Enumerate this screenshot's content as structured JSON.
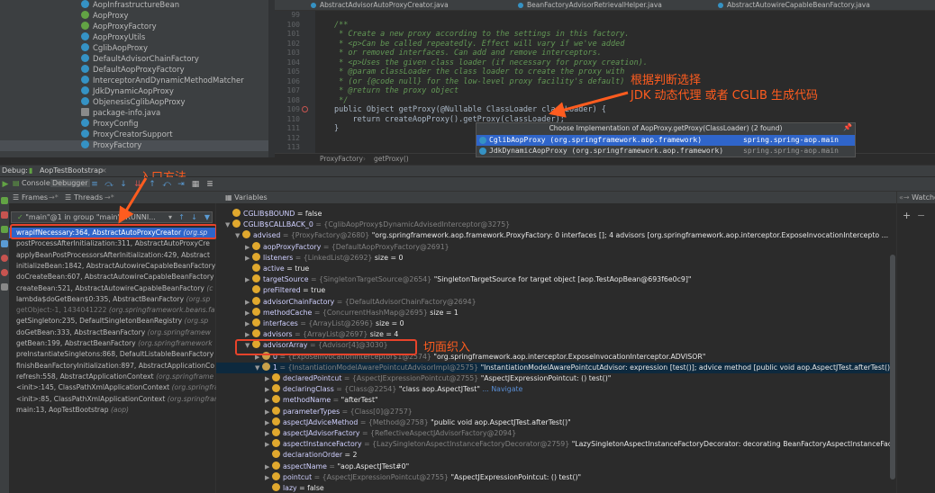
{
  "project_tree": {
    "items": [
      {
        "label": "AopInfrastructureBean",
        "icon": "class-icon"
      },
      {
        "label": "AopProxy",
        "icon": "interface-icon"
      },
      {
        "label": "AopProxyFactory",
        "icon": "interface-icon"
      },
      {
        "label": "AopProxyUtils",
        "icon": "class-icon"
      },
      {
        "label": "CglibAopProxy",
        "icon": "class-icon"
      },
      {
        "label": "DefaultAdvisorChainFactory",
        "icon": "class-icon"
      },
      {
        "label": "DefaultAopProxyFactory",
        "icon": "class-icon"
      },
      {
        "label": "InterceptorAndDynamicMethodMatcher",
        "icon": "class-icon"
      },
      {
        "label": "JdkDynamicAopProxy",
        "icon": "class-icon"
      },
      {
        "label": "ObjenesisCglibAopProxy",
        "icon": "class-icon"
      },
      {
        "label": "package-info.java",
        "icon": "file-icon"
      },
      {
        "label": "ProxyConfig",
        "icon": "class-icon"
      },
      {
        "label": "ProxyCreatorSupport",
        "icon": "class-icon"
      },
      {
        "label": "ProxyFactory",
        "icon": "class-icon"
      }
    ]
  },
  "editor_tabs": [
    {
      "label": "AbstractAdvisorAutoProxyCreator.java"
    },
    {
      "label": "BeanFactoryAdvisorRetrievalHelper.java"
    },
    {
      "label": "AbstractAutowireCapableBeanFactory.java"
    }
  ],
  "editor": {
    "line_numbers": [
      "99",
      "100",
      "101",
      "102",
      "103",
      "104",
      "105",
      "106",
      "107",
      "108",
      "109",
      "110",
      "111",
      "112",
      "113"
    ],
    "lines": [
      "",
      "/**",
      " * Create a new proxy according to the settings in this factory.",
      " * <p>Can be called repeatedly. Effect will vary if we've added",
      " * or removed interfaces. Can add and remove interceptors.",
      " * <p>Uses the given class loader (if necessary for proxy creation).",
      " * @param classLoader the class loader to create the proxy with",
      " * (or {@code null} for the low-level proxy facility's default)",
      " * @return the proxy object",
      " */",
      "public Object getProxy(@Nullable ClassLoader classLoader) {",
      "    return createAopProxy().getProxy(classLoader);",
      "}",
      "",
      ""
    ],
    "breadcrumb": [
      "ProxyFactory",
      "getProxy()"
    ]
  },
  "annotations": {
    "editor_note_line1": "根据判断选择",
    "editor_note_line2": "JDK 动态代理 或者 CGLIB 生成代码",
    "entry_note": "入口方法",
    "aop_note": "切面织入"
  },
  "implementations_popup": {
    "title": "Choose Implementation of AopProxy.getProxy(ClassLoader) (2 found)",
    "rows": [
      {
        "cls": "CglibAopProxy (org.springframework.aop.framework)",
        "module": "spring.spring-aop.main"
      },
      {
        "cls": "JdkDynamicAopProxy (org.springframework.aop.framework)",
        "module": "spring.spring-aop.main"
      }
    ]
  },
  "debug_bar": {
    "debug_label": "Debug:",
    "config_name": "AopTestBootstrap"
  },
  "toolbar": {
    "console_tab": "Console",
    "debugger_tab": "Debugger"
  },
  "frames_panel": {
    "frames_label": "Frames",
    "threads_label": "Threads",
    "thread_selector": "\"main\"@1 in group \"main\": RUNNI...",
    "frames": [
      {
        "m": "wrapIfNecessary:364, AbstractAutoProxyCreator",
        "p": "(org.sp"
      },
      {
        "m": "postProcessAfterInitialization:311, AbstractAutoProxyCre",
        "p": ""
      },
      {
        "m": "applyBeanPostProcessorsAfterInitialization:429, Abstract",
        "p": ""
      },
      {
        "m": "initializeBean:1842, AbstractAutowireCapableBeanFactory",
        "p": ""
      },
      {
        "m": "doCreateBean:607, AbstractAutowireCapableBeanFactory",
        "p": ""
      },
      {
        "m": "createBean:521, AbstractAutowireCapableBeanFactory",
        "p": "(c"
      },
      {
        "m": "lambda$doGetBean$0:335, AbstractBeanFactory",
        "p": "(org.sp"
      },
      {
        "m": "getObject:-1, 1434041222",
        "p": "(org.springframework.beans.fa"
      },
      {
        "m": "getSingleton:235, DefaultSingletonBeanRegistry",
        "p": "(org.sp"
      },
      {
        "m": "doGetBean:333, AbstractBeanFactory",
        "p": "(org.springframew"
      },
      {
        "m": "getBean:199, AbstractBeanFactory",
        "p": "(org.springframework"
      },
      {
        "m": "preInstantiateSingletons:868, DefaultListableBeanFactory",
        "p": ""
      },
      {
        "m": "finishBeanFactoryInitialization:897, AbstractApplicationCo",
        "p": ""
      },
      {
        "m": "refresh:558, AbstractApplicationContext",
        "p": "(org.springframe"
      },
      {
        "m": "<init>:145, ClassPathXmlApplicationContext",
        "p": "(org.springfra"
      },
      {
        "m": "<init>:85, ClassPathXmlApplicationContext",
        "p": "(org.springfram"
      },
      {
        "m": "main:13, AopTestBootstrap",
        "p": "(aop)"
      }
    ]
  },
  "variables_panel": {
    "title": "Variables",
    "rows": [
      {
        "indent": 0,
        "tri": "",
        "icon": "static",
        "name": "CGLIB$BOUND",
        "type": "",
        "value": "= false"
      },
      {
        "indent": 0,
        "tri": "▼",
        "icon": "static",
        "name": "CGLIB$CALLBACK_0",
        "type": "= {CglibAopProxy$DynamicAdvisedInterceptor@3275}",
        "value": ""
      },
      {
        "indent": 1,
        "tri": "▼",
        "icon": "field",
        "name": "advised",
        "type": "= {ProxyFactory@2680}",
        "value": "\"org.springframework.aop.framework.ProxyFactory: 0 interfaces []; 4 advisors [org.springframework.aop.interceptor.ExposeInvocationIntercepto ...",
        "link": "View"
      },
      {
        "indent": 2,
        "tri": "▶",
        "icon": "field",
        "name": "aopProxyFactory",
        "type": "= {DefaultAopProxyFactory@2691}",
        "value": ""
      },
      {
        "indent": 2,
        "tri": "▶",
        "icon": "field",
        "name": "listeners",
        "type": "= {LinkedList@2692}",
        "value": "size = 0"
      },
      {
        "indent": 2,
        "tri": "",
        "icon": "field",
        "name": "active",
        "type": "",
        "value": "= true"
      },
      {
        "indent": 2,
        "tri": "▶",
        "icon": "field",
        "name": "targetSource",
        "type": "= {SingletonTargetSource@2654}",
        "value": "\"SingletonTargetSource for target object [aop.TestAopBean@693f6e0c9]\""
      },
      {
        "indent": 2,
        "tri": "",
        "icon": "field",
        "name": "preFiltered",
        "type": "",
        "value": "= true"
      },
      {
        "indent": 2,
        "tri": "▶",
        "icon": "field",
        "name": "advisorChainFactory",
        "type": "= {DefaultAdvisorChainFactory@2694}",
        "value": ""
      },
      {
        "indent": 2,
        "tri": "▶",
        "icon": "field",
        "name": "methodCache",
        "type": "= {ConcurrentHashMap@2695}",
        "value": "size = 1"
      },
      {
        "indent": 2,
        "tri": "▶",
        "icon": "field",
        "name": "interfaces",
        "type": "= {ArrayList@2696}",
        "value": "size = 0"
      },
      {
        "indent": 2,
        "tri": "▶",
        "icon": "field",
        "name": "advisors",
        "type": "= {ArrayList@2697}",
        "value": "size = 4"
      },
      {
        "indent": 2,
        "tri": "▼",
        "icon": "field",
        "name": "advisorArray",
        "type": "= {Advisor[4]@3030}",
        "value": ""
      },
      {
        "indent": 3,
        "tri": "▶",
        "icon": "elem",
        "name": "0",
        "type": "= {ExposeInvocationInterceptor$1@2574}",
        "value": "\"org.springframework.aop.interceptor.ExposeInvocationInterceptor.ADVISOR\""
      },
      {
        "indent": 3,
        "tri": "▼",
        "icon": "elem",
        "name": "1",
        "type": "= {InstantiationModelAwarePointcutAdvisorImpl@2575}",
        "value": "\"InstantiationModelAwarePointcutAdvisor: expression [test()]; advice method [public void aop.AspectJTest.afterTest()]; p",
        "sel": true
      },
      {
        "indent": 4,
        "tri": "▶",
        "icon": "field",
        "name": "declaredPointcut",
        "type": "= {AspectJExpressionPointcut@2755}",
        "value": "\"AspectJExpressionPointcut: () test()\""
      },
      {
        "indent": 4,
        "tri": "▶",
        "icon": "field",
        "name": "declaringClass",
        "type": "= {Class@2254}",
        "value": "\"class aop.AspectJTest\"",
        "link": "... Navigate"
      },
      {
        "indent": 4,
        "tri": "▶",
        "icon": "field",
        "name": "methodName",
        "type": "=",
        "value": "\"afterTest\""
      },
      {
        "indent": 4,
        "tri": "▶",
        "icon": "field",
        "name": "parameterTypes",
        "type": "= {Class[0]@2757}",
        "value": ""
      },
      {
        "indent": 4,
        "tri": "▶",
        "icon": "field",
        "name": "aspectJAdviceMethod",
        "type": "= {Method@2758}",
        "value": "\"public void aop.AspectJTest.afterTest()\""
      },
      {
        "indent": 4,
        "tri": "▶",
        "icon": "field",
        "name": "aspectJAdvisorFactory",
        "type": "= {ReflectiveAspectJAdvisorFactory@2094}",
        "value": ""
      },
      {
        "indent": 4,
        "tri": "▶",
        "icon": "field",
        "name": "aspectInstanceFactory",
        "type": "= {LazySingletonAspectInstanceFactoryDecorator@2759}",
        "value": "\"LazySingletonAspectInstanceFactoryDecorator: decorating BeanFactoryAspectInstanceFactory"
      },
      {
        "indent": 4,
        "tri": "",
        "icon": "field",
        "name": "declarationOrder",
        "type": "",
        "value": "= 2"
      },
      {
        "indent": 4,
        "tri": "▶",
        "icon": "field",
        "name": "aspectName",
        "type": "=",
        "value": "\"aop.AspectJTest#0\""
      },
      {
        "indent": 4,
        "tri": "▶",
        "icon": "field",
        "name": "pointcut",
        "type": "= {AspectJExpressionPointcut@2755}",
        "value": "\"AspectJExpressionPointcut: () test()\""
      },
      {
        "indent": 4,
        "tri": "",
        "icon": "field",
        "name": "lazy",
        "type": "",
        "value": "= false"
      }
    ]
  },
  "watches_panel": {
    "title": "Watches"
  },
  "colors": {
    "annotation_red": "#e8432a",
    "annotation_orange": "#ff5c1f",
    "selection_blue": "#2f65ca"
  }
}
